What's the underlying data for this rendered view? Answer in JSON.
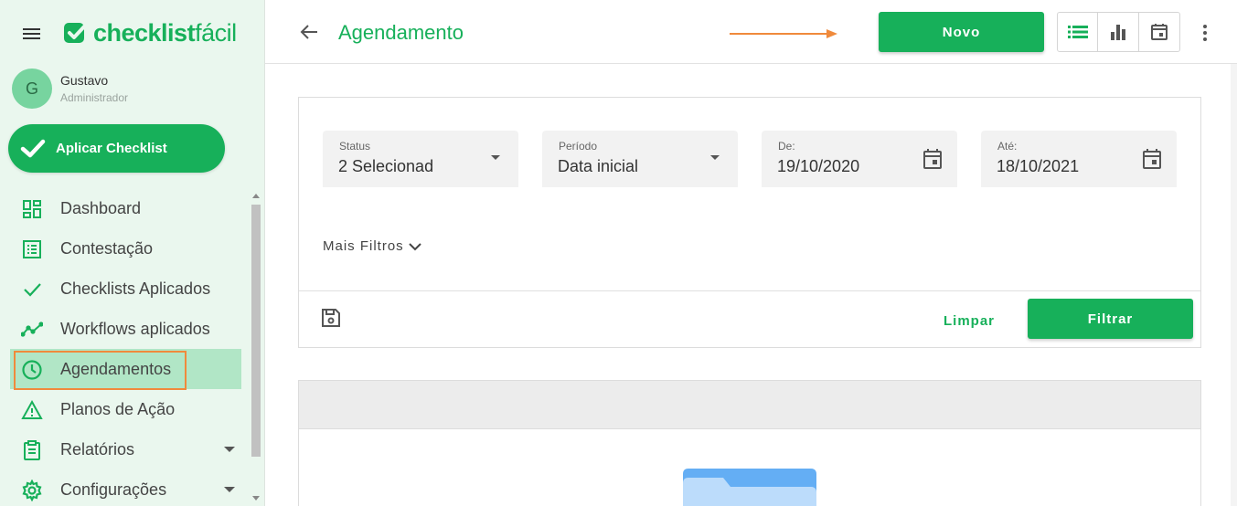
{
  "brand": {
    "name_bold": "checklist",
    "name_light": "fácil",
    "accent": "#17b05a"
  },
  "user": {
    "initial": "G",
    "name": "Gustavo",
    "role": "Administrador"
  },
  "apply_button": {
    "label": "Aplicar Checklist",
    "icon": "check-icon"
  },
  "nav": {
    "items": [
      {
        "label": "Dashboard",
        "icon": "dashboard-icon"
      },
      {
        "label": "Contestação",
        "icon": "list-icon"
      },
      {
        "label": "Checklists Aplicados",
        "icon": "check-icon"
      },
      {
        "label": "Workflows aplicados",
        "icon": "trend-icon"
      },
      {
        "label": "Agendamentos",
        "icon": "clock-icon",
        "active": true
      },
      {
        "label": "Planos de Ação",
        "icon": "warning-icon"
      },
      {
        "label": "Relatórios",
        "icon": "report-icon",
        "expandable": true
      },
      {
        "label": "Configurações",
        "icon": "gear-icon",
        "expandable": true
      }
    ]
  },
  "header": {
    "title": "Agendamento",
    "new_button": "Novo",
    "views": [
      "list-view-icon",
      "chart-view-icon",
      "calendar-view-icon"
    ]
  },
  "filters": {
    "status": {
      "label": "Status",
      "value": "2 Selecionad"
    },
    "periodo": {
      "label": "Período",
      "value": "Data inicial"
    },
    "de": {
      "label": "De:",
      "value": "19/10/2020"
    },
    "ate": {
      "label": "Até:",
      "value": "18/10/2021"
    },
    "more": "Mais Filtros",
    "clear": "Limpar",
    "apply": "Filtrar"
  }
}
